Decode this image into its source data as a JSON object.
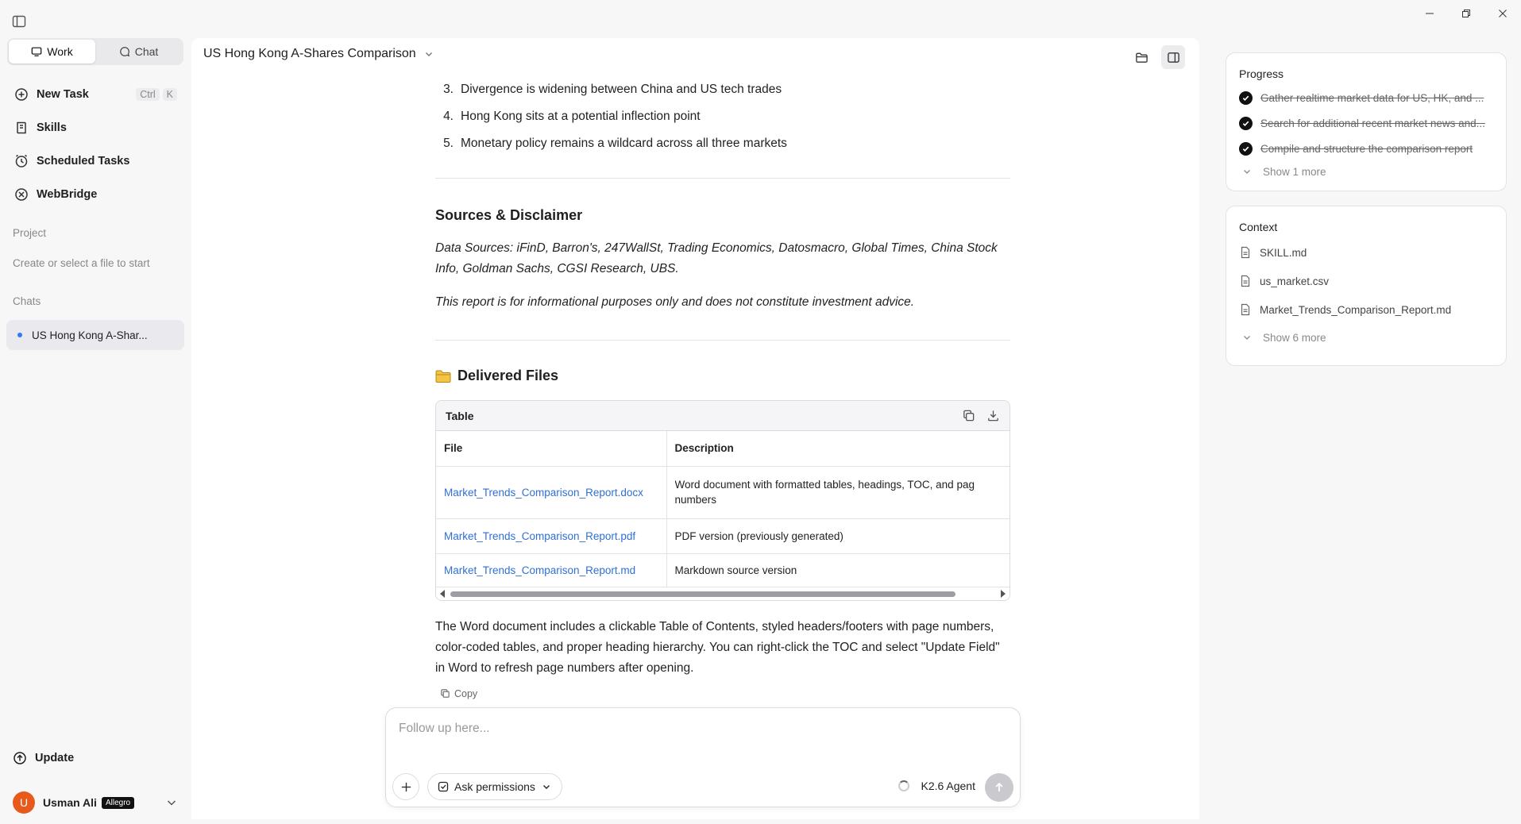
{
  "sidebar": {
    "modes": [
      {
        "label": "Work",
        "active": true
      },
      {
        "label": "Chat",
        "active": false
      }
    ],
    "nav": [
      {
        "label": "New Task",
        "shortcut": [
          "Ctrl",
          "K"
        ]
      },
      {
        "label": "Skills"
      },
      {
        "label": "Scheduled Tasks"
      },
      {
        "label": "WebBridge"
      }
    ],
    "project_label": "Project",
    "project_hint": "Create or select a file to start",
    "chats_label": "Chats",
    "chats": [
      {
        "label": "US Hong Kong A-Shar..."
      }
    ],
    "update_label": "Update",
    "user": {
      "initial": "U",
      "name": "Usman Ali",
      "badge": "Allegro"
    }
  },
  "header": {
    "title": "US Hong Kong A-Shares Comparison"
  },
  "content": {
    "findings": [
      {
        "num": "3.",
        "text": "Divergence is widening between China and US tech trades"
      },
      {
        "num": "4.",
        "text": "Hong Kong sits at a potential inflection point"
      },
      {
        "num": "5.",
        "text": "Monetary policy remains a wildcard across all three markets"
      }
    ],
    "sources_heading": "Sources & Disclaimer",
    "sources_text": "Data Sources: iFinD, Barron's, 247WallSt, Trading Economics, Datosmacro, Global Times, China Stock Info, Goldman Sachs, CGSI Research, UBS.",
    "disclaimer_text": "This report is for informational purposes only and does not constitute investment advice.",
    "delivered_heading": "Delivered Files",
    "table": {
      "title": "Table",
      "columns": [
        "File",
        "Description"
      ],
      "rows": [
        {
          "file": "Market_Trends_Comparison_Report.docx",
          "desc": "Word document with formatted tables, headings, TOC, and pag",
          "desc2": "numbers"
        },
        {
          "file": "Market_Trends_Comparison_Report.pdf",
          "desc": "PDF version (previously generated)"
        },
        {
          "file": "Market_Trends_Comparison_Report.md",
          "desc": "Markdown source version"
        }
      ]
    },
    "closing_text": "The Word document includes a clickable Table of Contents, styled headers/footers with page numbers, color-coded tables, and proper heading hierarchy. You can right-click the TOC and select \"Update Field\" in Word to refresh page numbers after opening.",
    "copy_label": "Copy"
  },
  "composer": {
    "placeholder": "Follow up here...",
    "permissions_label": "Ask permissions",
    "agent_label": "K2.6 Agent"
  },
  "progress": {
    "title": "Progress",
    "tasks": [
      "Gather realtime market data for US, HK, and ...",
      "Search for additional recent market news and...",
      "Compile and structure the comparison report"
    ],
    "more_label": "Show 1 more"
  },
  "context": {
    "title": "Context",
    "files": [
      "SKILL.md",
      "us_market.csv",
      "Market_Trends_Comparison_Report.md"
    ],
    "more_label": "Show 6 more"
  }
}
